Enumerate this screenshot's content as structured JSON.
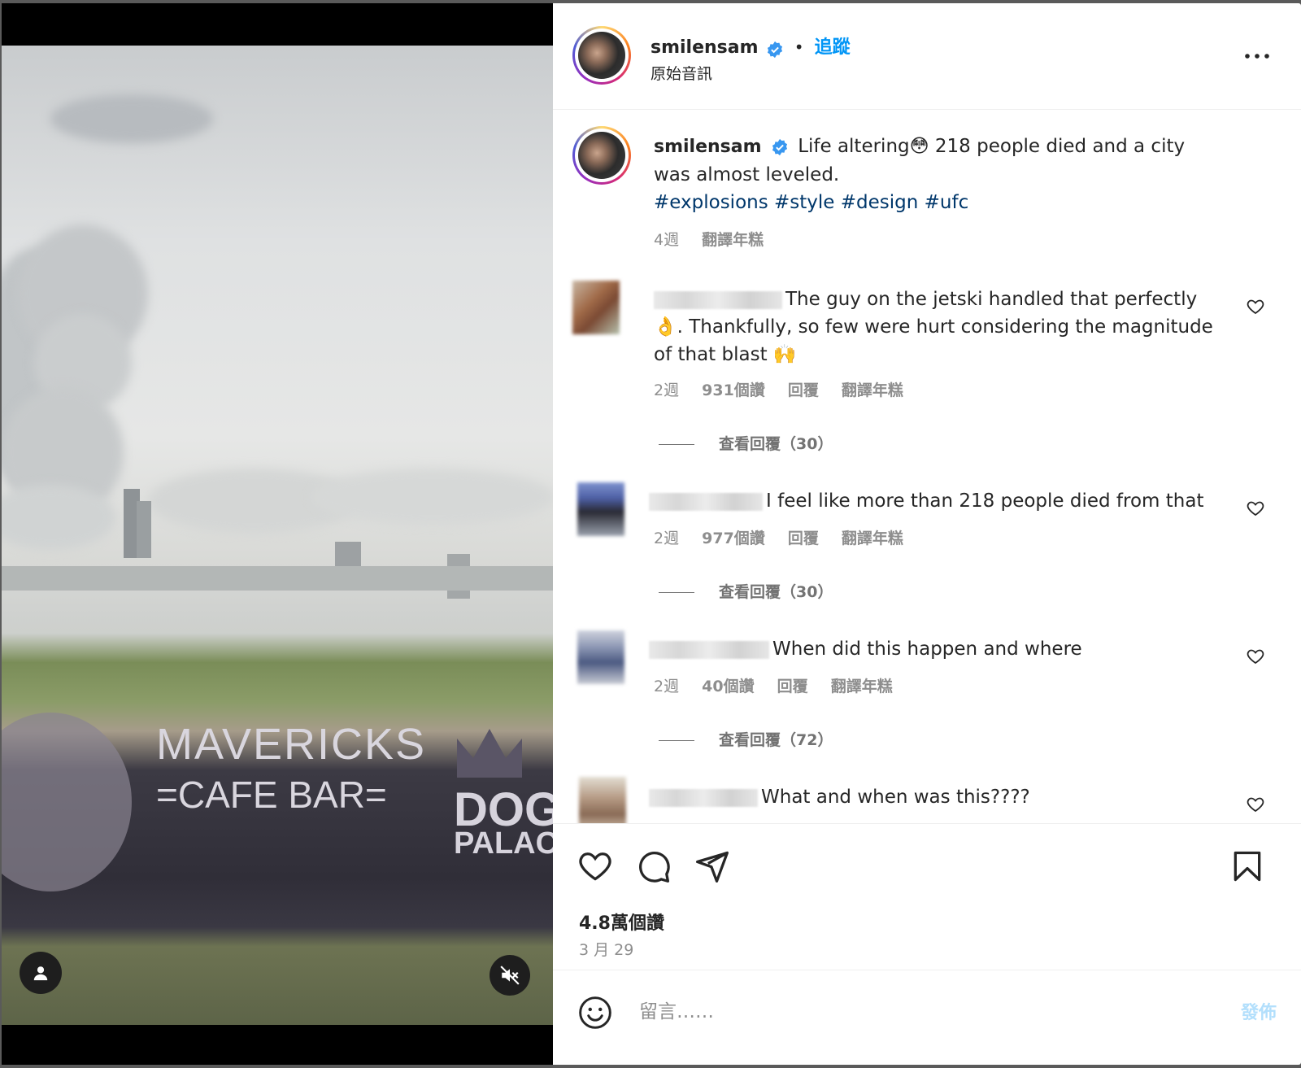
{
  "post": {
    "username": "smilensam",
    "separator": "•",
    "follow_label": "追蹤",
    "audio_label": "原始音訊"
  },
  "caption": {
    "username": "smilensam",
    "text": "Life altering😳 218 people died and a city was almost leveled.",
    "hashtags": "#explosions #style #design #ufc",
    "age": "4週",
    "translate": "翻譯年糕"
  },
  "comments": [
    {
      "text": "The guy on the jetski handled that perfectly 👌. Thankfully, so few were hurt considering the magnitude of that blast 🙌",
      "age": "2週",
      "likes": "931個讚",
      "reply": "回覆",
      "translate": "翻譯年糕",
      "view_replies": "查看回覆（30）"
    },
    {
      "text": "I feel like more than 218 people died from that",
      "age": "2週",
      "likes": "977個讚",
      "reply": "回覆",
      "translate": "翻譯年糕",
      "view_replies": "查看回覆（30）"
    },
    {
      "text": "When did this happen and where",
      "age": "2週",
      "likes": "40個讚",
      "reply": "回覆",
      "translate": "翻譯年糕",
      "view_replies": "查看回覆（72）"
    },
    {
      "text": "What and when was this????"
    }
  ],
  "stats": {
    "likes": "4.8萬個讚",
    "date": "3 月 29"
  },
  "composer": {
    "placeholder": "留言……",
    "post_label": "發佈"
  },
  "video": {
    "sign_main": "MAVERICKS",
    "sign_sub": "=CAFE BAR=",
    "sign2_line1": "DOG",
    "sign2_line2": "PALACE"
  },
  "colors": {
    "follow": "#0095f6",
    "verified": "#3897f0",
    "hashtag": "#00376b",
    "post_disabled": "#b2dffc"
  },
  "icons": [
    "verified-icon",
    "more-options-icon",
    "heart-icon",
    "comment-icon",
    "share-icon",
    "bookmark-icon",
    "emoji-icon",
    "user-tag-icon",
    "muted-speaker-icon"
  ]
}
